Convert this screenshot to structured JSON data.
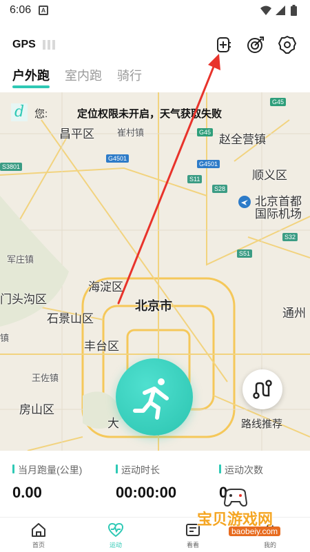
{
  "status": {
    "time": "6:06",
    "sim_letter": "A"
  },
  "header": {
    "gps_label": "GPS",
    "tabs": [
      {
        "label": "户外跑",
        "active": true
      },
      {
        "label": "室内跑",
        "active": false
      },
      {
        "label": "骑行",
        "active": false
      }
    ]
  },
  "map": {
    "notice_greeting": "您:",
    "notice_message": "定位权限未开启，天气获取失败",
    "labels": {
      "changping": "昌平区",
      "cuicun": "崔村镇",
      "zhaoquanying": "赵全营镇",
      "shunyi": "顺义区",
      "airport_line1": "北京首都",
      "airport_line2": "国际机场",
      "junzhuang": "军庄镇",
      "haidian": "海淀区",
      "mentougou": "门头沟区",
      "beijing": "北京市",
      "shijingshan": "石景山区",
      "tongzhou": "通州",
      "fengtai": "丰台区",
      "wangzuo": "王佐镇",
      "fangshan": "房山区",
      "daxing_partial": "大",
      "zhen_partial": "镇"
    },
    "shields": {
      "g45a": "G45",
      "g45b": "G45",
      "g4501a": "G4501",
      "g4501b": "G4501",
      "s3801": "S3801",
      "s11": "S11",
      "s28": "S28",
      "s32": "S32",
      "s51": "S51"
    },
    "route_label": "路线推荐"
  },
  "stats": [
    {
      "title": "当月跑量(公里)",
      "value": "0.00"
    },
    {
      "title": "运动时长",
      "value": "00:00:00"
    },
    {
      "title": "运动次数",
      "value": "0"
    }
  ],
  "tabbar": [
    {
      "label": "首页",
      "icon": "home-icon"
    },
    {
      "label": "运动",
      "icon": "heart-pulse-icon"
    },
    {
      "label": "看看",
      "icon": "news-icon"
    },
    {
      "label": "我的",
      "icon": "user-icon"
    }
  ],
  "watermark": {
    "title": "宝贝游戏网",
    "url": "baobeiy.com"
  },
  "colors": {
    "accent": "#2ec9b5",
    "arrow": "#e8332b"
  }
}
